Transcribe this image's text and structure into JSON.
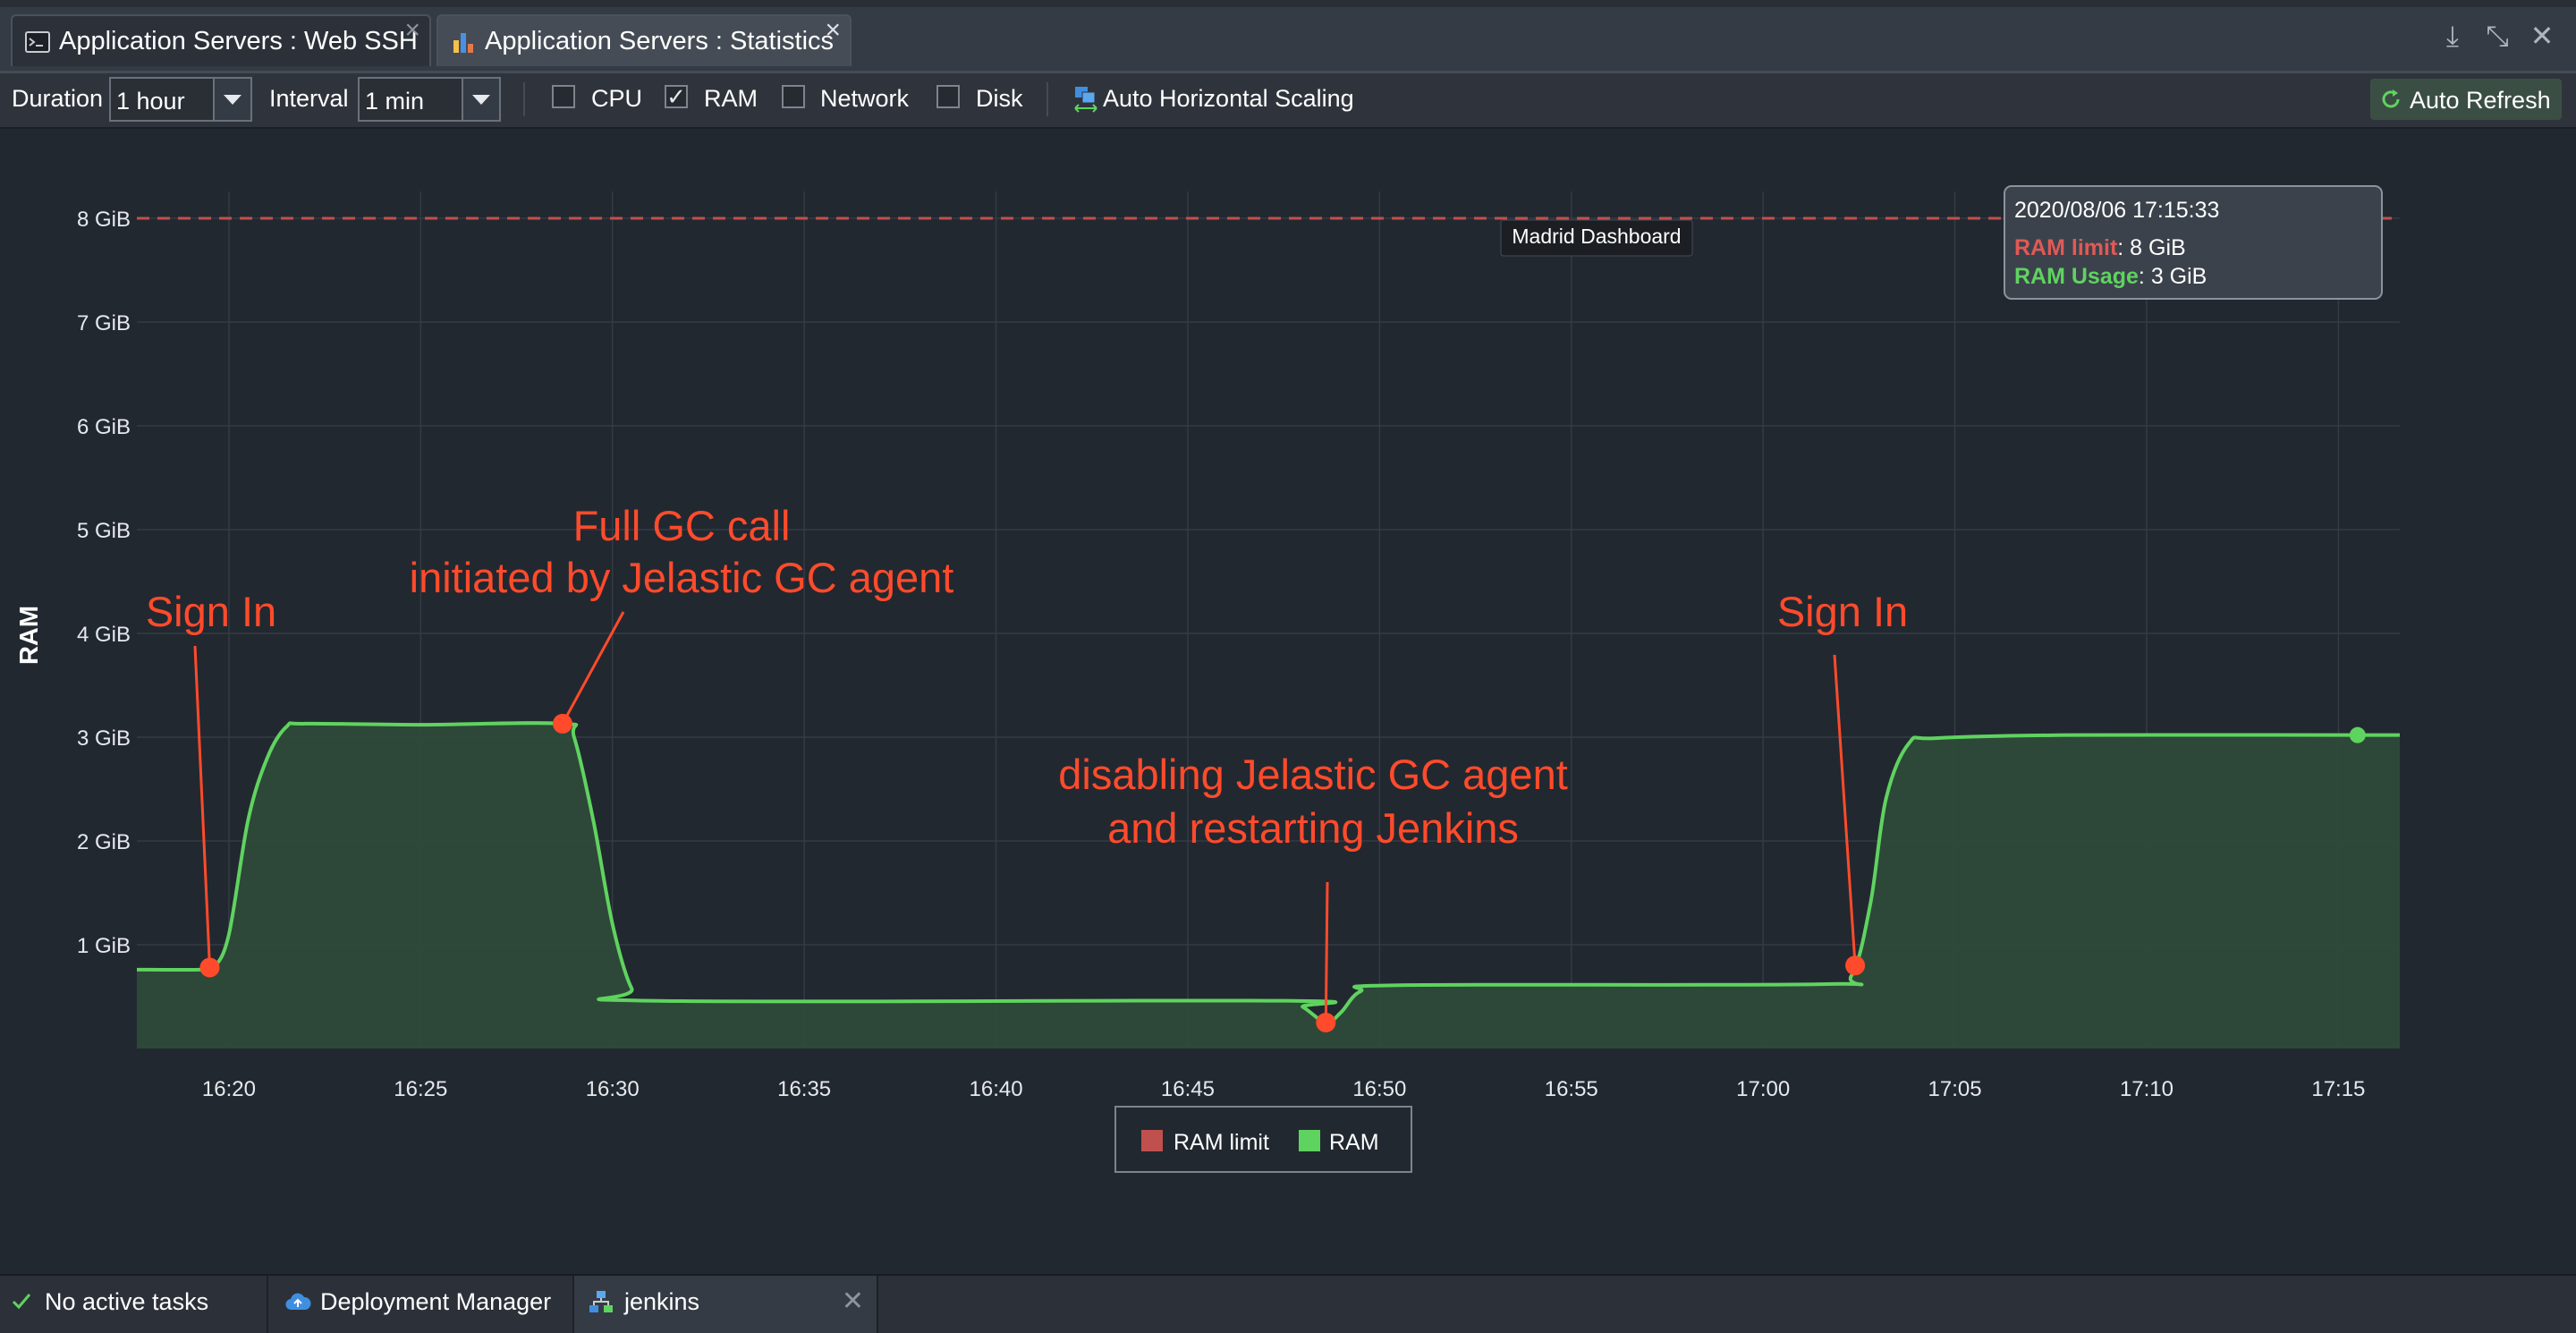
{
  "tabs": [
    {
      "label": "Application Servers : Web SSH",
      "icon": "terminal-icon"
    },
    {
      "label": "Application Servers : Statistics",
      "icon": "bar-chart-icon"
    }
  ],
  "toolbar": {
    "duration_label": "Duration",
    "duration_value": "1 hour",
    "interval_label": "Interval",
    "interval_value": "1 min",
    "checkboxes": [
      {
        "label": "CPU",
        "checked": false
      },
      {
        "label": "RAM",
        "checked": true
      },
      {
        "label": "Network",
        "checked": false
      },
      {
        "label": "Disk",
        "checked": false
      }
    ],
    "auto_scaling_label": "Auto Horizontal Scaling",
    "auto_refresh_label": "Auto Refresh"
  },
  "tooltip": {
    "timestamp": "2020/08/06 17:15:33",
    "limit_label": "RAM limit",
    "limit_value": ": 8 GiB",
    "usage_label": "RAM Usage",
    "usage_value": ": 3 GiB"
  },
  "hover_tag": "Madrid Dashboard",
  "annotations": [
    {
      "lines": [
        "Sign In"
      ],
      "time": "16:19.5",
      "value": 0.78
    },
    {
      "lines": [
        "Full GC call",
        "initiated by Jelastic GC agent"
      ],
      "time": "16:28.7",
      "value": 3.13
    },
    {
      "lines": [
        "disabling Jelastic GC agent",
        "and restarting Jenkins"
      ],
      "time": "16:48.6",
      "value": 0.25
    },
    {
      "lines": [
        "Sign In"
      ],
      "time": "17:02.4",
      "value": 0.8
    }
  ],
  "colors": {
    "ram": "#5fd35f",
    "ram_fill": "#2e4a3a",
    "limit": "#c0504d",
    "annotation": "#ff4b2b",
    "grid": "#343b44"
  },
  "chart_data": {
    "type": "area",
    "ylabel": "RAM",
    "y_ticks": [
      "1 GiB",
      "2 GiB",
      "3 GiB",
      "4 GiB",
      "5 GiB",
      "6 GiB",
      "7 GiB",
      "8 GiB"
    ],
    "ylim": [
      0,
      8
    ],
    "x_ticks": [
      "16:20",
      "16:25",
      "16:30",
      "16:35",
      "16:40",
      "16:45",
      "16:50",
      "16:55",
      "17:00",
      "17:05",
      "17:10",
      "17:15"
    ],
    "xlim": [
      "16:17.6",
      "17:16.6"
    ],
    "legend_position": "bottom-center",
    "grid": true,
    "series": [
      {
        "name": "RAM limit",
        "style": "dashed",
        "points": [
          [
            "16:17.6",
            8
          ],
          [
            "17:16.6",
            8
          ]
        ]
      },
      {
        "name": "RAM",
        "style": "area",
        "points": [
          [
            "16:17.6",
            0.76
          ],
          [
            "16:19.2",
            0.76
          ],
          [
            "16:19.6",
            0.78
          ],
          [
            "16:20.0",
            1.1
          ],
          [
            "16:20.5",
            2.2
          ],
          [
            "16:21.0",
            2.8
          ],
          [
            "16:21.5",
            3.1
          ],
          [
            "16:22.0",
            3.13
          ],
          [
            "16:25.0",
            3.12
          ],
          [
            "16:28.7",
            3.13
          ],
          [
            "16:29.0",
            3.0
          ],
          [
            "16:29.5",
            2.2
          ],
          [
            "16:30.0",
            1.2
          ],
          [
            "16:30.5",
            0.58
          ],
          [
            "16:31.0",
            0.46
          ],
          [
            "16:47.5",
            0.46
          ],
          [
            "16:48.0",
            0.4
          ],
          [
            "16:48.6",
            0.25
          ],
          [
            "16:49.0",
            0.35
          ],
          [
            "16:49.5",
            0.55
          ],
          [
            "16:50.5",
            0.61
          ],
          [
            "17:01.5",
            0.62
          ],
          [
            "17:02.3",
            0.7
          ],
          [
            "17:02.8",
            1.4
          ],
          [
            "17:03.2",
            2.4
          ],
          [
            "17:03.8",
            2.94
          ],
          [
            "17:04.5",
            2.99
          ],
          [
            "17:08.0",
            3.02
          ],
          [
            "17:15.5",
            3.02
          ],
          [
            "17:16.6",
            3.02
          ]
        ]
      }
    ],
    "highlight_point": [
      "17:15.5",
      3.02
    ]
  },
  "bottom": {
    "tasks": "No active tasks",
    "deployment": "Deployment Manager",
    "env": "jenkins"
  }
}
